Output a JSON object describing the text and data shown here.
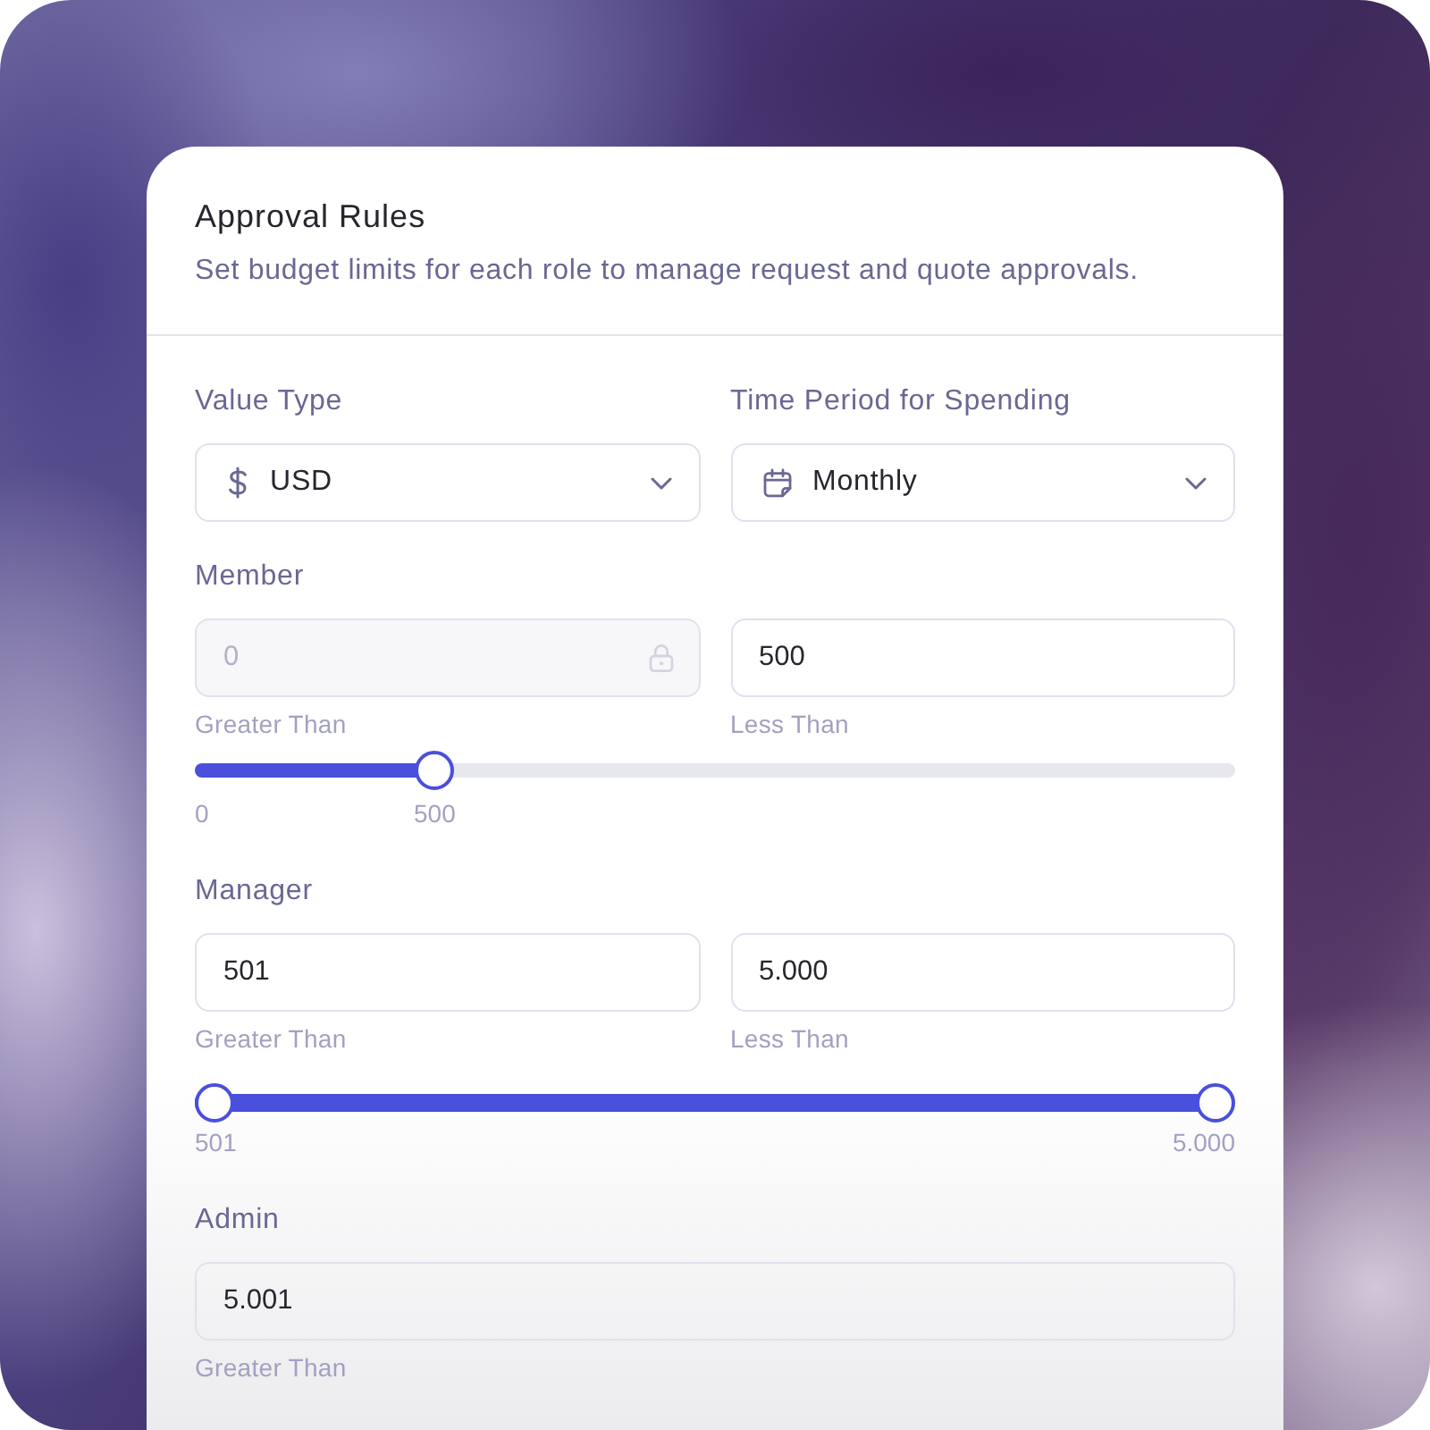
{
  "card": {
    "title": "Approval Rules",
    "subtitle": "Set budget limits for each role to manage request and quote approvals."
  },
  "selects": [
    {
      "kind": "currency",
      "label": "Value Type",
      "value": "USD"
    },
    {
      "kind": "calendar",
      "label": "Time Period for Spending",
      "value": "Monthly"
    }
  ],
  "roles": [
    {
      "name": "Member",
      "fields": [
        {
          "value": "0",
          "helper": "Greater Than",
          "disabled": true
        },
        {
          "value": "500",
          "helper": "Less Than",
          "disabled": false
        }
      ],
      "slider": {
        "kind": "single",
        "level": 0.22,
        "min_label": "0",
        "value_label": "500"
      }
    },
    {
      "name": "Manager",
      "fields": [
        {
          "value": "501",
          "helper": "Greater Than",
          "disabled": false
        },
        {
          "value": "5.000",
          "helper": "Less Than",
          "disabled": false
        }
      ],
      "slider": {
        "kind": "range",
        "level": 1,
        "min_label": "501",
        "value_label": "5.000"
      }
    },
    {
      "name": "Admin",
      "fields": [
        {
          "value": "5.001",
          "helper": "Greater Than",
          "disabled": false
        }
      ]
    }
  ]
}
